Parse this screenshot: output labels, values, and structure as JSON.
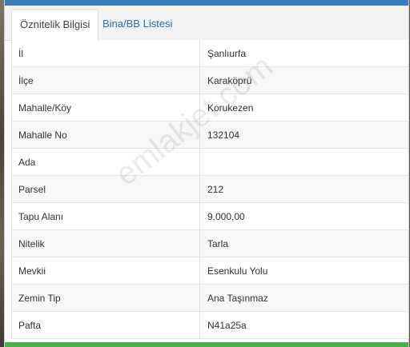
{
  "tabs": [
    {
      "label": "Öznitelik Bilgisi",
      "active": true
    },
    {
      "label": "Bina/BB Listesi",
      "active": false
    }
  ],
  "rows": [
    {
      "label": "İl",
      "value": "Şanlıurfa"
    },
    {
      "label": "İlçe",
      "value": "Karaköprü"
    },
    {
      "label": "Mahalle/Köy",
      "value": "Korukezen"
    },
    {
      "label": "Mahalle No",
      "value": "132104"
    },
    {
      "label": "Ada",
      "value": ""
    },
    {
      "label": "Parsel",
      "value": "212"
    },
    {
      "label": "Tapu Alanı",
      "value": "9.000,00"
    },
    {
      "label": "Nitelik",
      "value": "Tarla"
    },
    {
      "label": "Mevkii",
      "value": "Esenkulu Yolu"
    },
    {
      "label": "Zemin Tip",
      "value": "Ana Taşınmaz"
    },
    {
      "label": "Pafta",
      "value": "N41a25a"
    }
  ],
  "watermark": "emlakjet.com",
  "colors": {
    "top_strip": "#3a7cc0",
    "bottom_strip": "#4cae4c",
    "link": "#2a6fb0"
  }
}
